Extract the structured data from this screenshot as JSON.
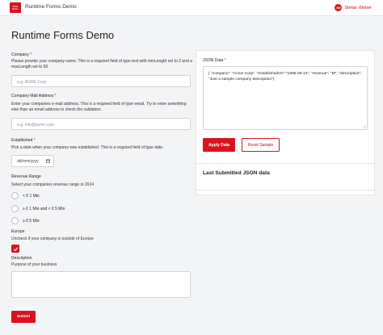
{
  "header": {
    "logo_line1": "Ortec",
    "logo_line2": "Ortec",
    "title": "Runtime Forms Demo",
    "user_initials": "SW",
    "user_name": "Stefan Weber"
  },
  "page_title": "Runtime Forms Demo",
  "form": {
    "company": {
      "label": "Company",
      "required_mark": "*",
      "help": "Please provide your company name. This is a required field of type text with minLength set to 2 and a maxLength set to 50",
      "placeholder": "e.g. ACME Corp"
    },
    "email": {
      "label": "Company Mail Address",
      "required_mark": "*",
      "help": "Enter your companies e-mail address. This is a required field of type email. Try to enter something else than an email address to check the validation.",
      "placeholder": "e.g. info@acme.com"
    },
    "established": {
      "label": "Established",
      "required_mark": "*",
      "help": "Pick a date when your company was established. This is a required field of type date.",
      "placeholder": "dd/mm/yyyy"
    },
    "revenue": {
      "label": "Revenue Range",
      "help": "Select your companies revenue range in 2024",
      "options": [
        "< € 1 Mio",
        "≥ € 1 Mio and < € 5 Mio",
        "≥ € 5 Mio"
      ]
    },
    "europe": {
      "label": "Europe",
      "help": "Uncheck if your company is outside of Europe",
      "checked": true
    },
    "description": {
      "label": "Description",
      "help": "Purpose of your business",
      "value": ""
    },
    "submit_label": "Submit"
  },
  "json_panel": {
    "label": "JSON Data",
    "required_mark": "*",
    "value": "{ \"company\": \"Acme Corp\", \"establishedOn\":\"1995-06-14\", \"revenue\": \"M\", \"description\": \"Just a sample company description\"}",
    "apply_label": "Apply Data",
    "reset_label": "Reset Sample"
  },
  "last_submitted": {
    "title": "Last Submitted JSON data"
  },
  "colors": {
    "brand": "#d9131d",
    "background": "#f3f4f6"
  },
  "icons": {
    "calendar": "calendar-icon",
    "check": "check-icon",
    "resize": "resize-handle-icon"
  }
}
